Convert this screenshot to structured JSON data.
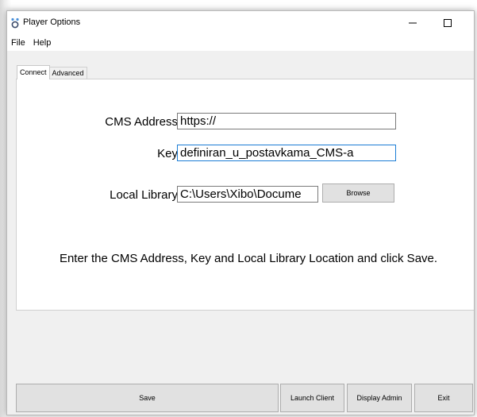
{
  "window": {
    "title": "Player Options",
    "controls": {
      "minimize": "—",
      "maximize": "☐",
      "close": "✕"
    },
    "icon": "xibo-app-icon"
  },
  "menu": {
    "items": [
      {
        "label": "File"
      },
      {
        "label": "Help"
      }
    ]
  },
  "tabs": [
    {
      "label": "Connect",
      "active": true
    },
    {
      "label": "Advanced",
      "active": false
    }
  ],
  "connect": {
    "cms_address": {
      "label": "CMS Address",
      "value": "https://"
    },
    "key": {
      "label": "Key",
      "value": "definiran_u_postavkama_CMS-a"
    },
    "local_library": {
      "label": "Local Library",
      "value": "C:\\Users\\Xibo\\Docume"
    },
    "browse_label": "Browse",
    "hint": "Enter the CMS Address, Key and Local Library Location and click Save."
  },
  "actions": {
    "save": "Save",
    "launch_client": "Launch Client",
    "display_admin": "Display Admin",
    "exit": "Exit"
  },
  "colors": {
    "focus_border": "#1b7cd5",
    "button_face": "#e1e1e1",
    "window_bg": "#f0f0f0"
  }
}
